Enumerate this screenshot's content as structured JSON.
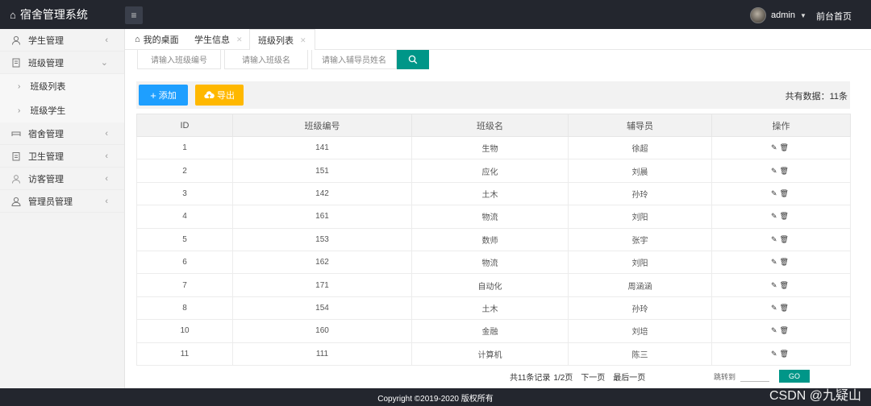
{
  "app": {
    "title": "宿舍管理系统"
  },
  "header": {
    "username": "admin",
    "home_link": "前台首页"
  },
  "sidebar": {
    "items": [
      {
        "label": "学生管理",
        "icon": "user-icon"
      },
      {
        "label": "班级管理",
        "icon": "document-icon",
        "expanded": true,
        "children": [
          {
            "label": "班级列表"
          },
          {
            "label": "班级学生"
          }
        ]
      },
      {
        "label": "宿舍管理",
        "icon": "bed-icon"
      },
      {
        "label": "卫生管理",
        "icon": "clipboard-icon"
      },
      {
        "label": "访客管理",
        "icon": "visitor-icon"
      },
      {
        "label": "管理员管理",
        "icon": "admin-icon"
      }
    ]
  },
  "tabs": [
    {
      "label": "我的桌面",
      "icon": "home-icon"
    },
    {
      "label": "学生信息",
      "closable": true
    },
    {
      "label": "班级列表",
      "closable": true,
      "active": true
    }
  ],
  "search": {
    "class_no_placeholder": "请输入班级编号",
    "class_name_placeholder": "请输入班级名",
    "counselor_placeholder": "请输入辅导员姓名"
  },
  "toolbar": {
    "add_label": "添加",
    "export_label": "导出",
    "total_text": "共有数据：11条"
  },
  "table": {
    "columns": [
      "ID",
      "班级编号",
      "班级名",
      "辅导员",
      "操作"
    ],
    "rows": [
      [
        "1",
        "141",
        "生物",
        "徐超"
      ],
      [
        "2",
        "151",
        "应化",
        "刘晨"
      ],
      [
        "3",
        "142",
        "土木",
        "孙玲"
      ],
      [
        "4",
        "161",
        "物流",
        "刘阳"
      ],
      [
        "5",
        "153",
        "数师",
        "张宇"
      ],
      [
        "6",
        "162",
        "物流",
        "刘阳"
      ],
      [
        "7",
        "171",
        "自动化",
        "周涵涵"
      ],
      [
        "8",
        "154",
        "土木",
        "孙玲"
      ],
      [
        "10",
        "160",
        "金融",
        "刘培"
      ],
      [
        "11",
        "111",
        "计算机",
        "陈三"
      ]
    ]
  },
  "pagination": {
    "records_text": "共11条记录",
    "page_text": "1/2页",
    "next_label": "下一页",
    "last_label": "最后一页",
    "jump_label": "跳转到",
    "go_label": "GO"
  },
  "footer": {
    "copyright": "Copyright ©2019-2020 版权所有"
  },
  "watermark": "CSDN @九疑山",
  "colors": {
    "topbar": "#23262e",
    "teal": "#009688",
    "blue": "#1e9fff",
    "orange": "#ffb800"
  }
}
